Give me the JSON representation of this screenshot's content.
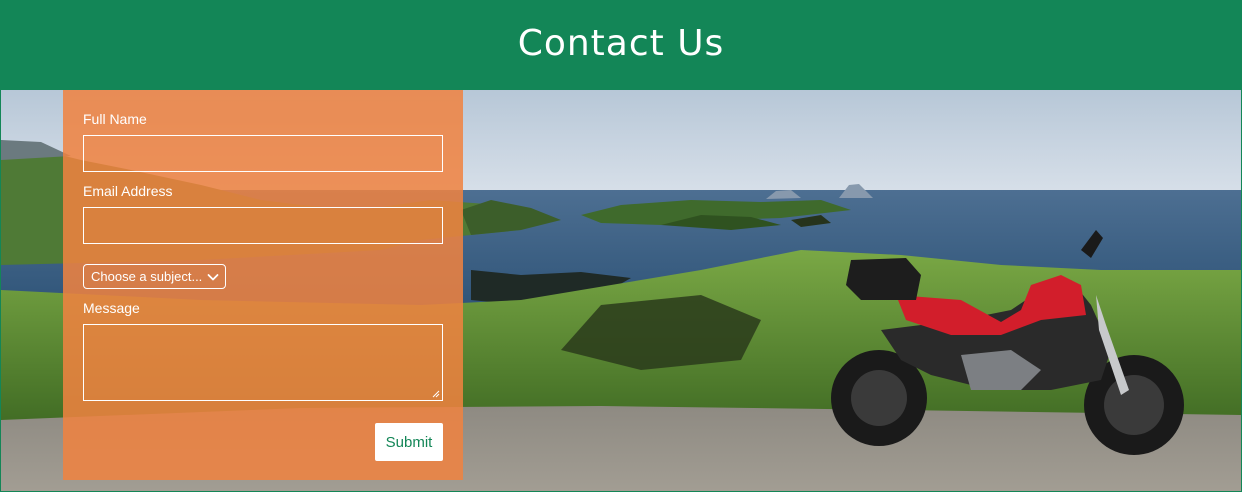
{
  "header": {
    "title": "Contact Us"
  },
  "form": {
    "full_name": {
      "label": "Full Name",
      "value": "",
      "placeholder": ""
    },
    "email": {
      "label": "Email Address",
      "value": "",
      "placeholder": ""
    },
    "subject": {
      "selected": "Choose a subject..."
    },
    "message": {
      "label": "Message",
      "value": "",
      "placeholder": ""
    },
    "submit_label": "Submit"
  },
  "colors": {
    "header_bg": "#138657",
    "form_panel": "#F08240",
    "submit_text": "#138657"
  },
  "background": {
    "description_icon": "motorcycle-coast-photo"
  }
}
